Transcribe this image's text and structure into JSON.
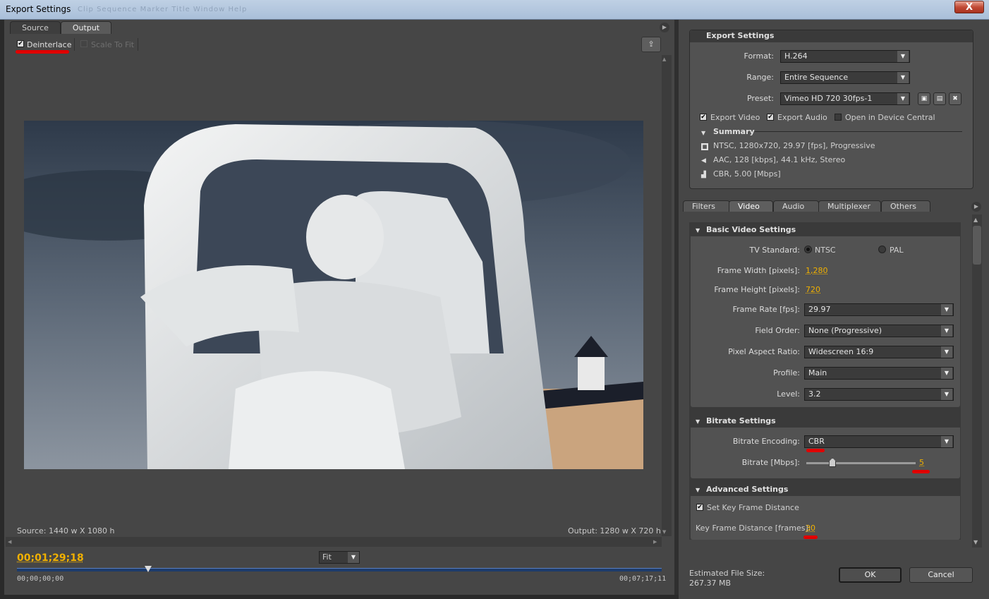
{
  "window": {
    "title": "Export Settings",
    "menu_ghost": "Clip Sequence Marker Title Window Help",
    "close_glyph": "X"
  },
  "left": {
    "tabs": [
      {
        "label": "Source"
      },
      {
        "label": "Output"
      }
    ],
    "deinterlace": {
      "label": "Deinterlace",
      "checked": true
    },
    "scale_to_fit": {
      "label": "Scale To Fit",
      "checked": false,
      "disabled": true
    },
    "source_info": "Source: 1440 w X 1080 h",
    "output_info": "Output: 1280 w X 720 h",
    "timecode": "00;01;29;18",
    "zoom": "Fit",
    "time_start": "00;00;00;00",
    "time_end": "00;07;17;11",
    "playhead_fraction": 0.204
  },
  "export_settings": {
    "header": "Export Settings",
    "format": {
      "label": "Format:",
      "value": "H.264"
    },
    "range": {
      "label": "Range:",
      "value": "Entire Sequence"
    },
    "preset": {
      "label": "Preset:",
      "value": "Vimeo HD 720 30fps-1"
    },
    "export_video": {
      "label": "Export Video",
      "checked": true
    },
    "export_audio": {
      "label": "Export Audio",
      "checked": true
    },
    "device_central": {
      "label": "Open in Device Central",
      "checked": false
    },
    "summary": {
      "label": "Summary",
      "lines": [
        "NTSC, 1280x720, 29.97 [fps], Progressive",
        "AAC, 128 [kbps], 44.1 kHz, Stereo",
        "CBR, 5.00 [Mbps]"
      ]
    }
  },
  "tabs": [
    {
      "label": "Filters"
    },
    {
      "label": "Video"
    },
    {
      "label": "Audio"
    },
    {
      "label": "Multiplexer"
    },
    {
      "label": "Others"
    }
  ],
  "basic_video": {
    "header": "Basic Video Settings",
    "tv_standard": {
      "label": "TV Standard:",
      "ntsc": "NTSC",
      "pal": "PAL",
      "selected": "NTSC"
    },
    "frame_width": {
      "label": "Frame Width [pixels]:",
      "value": "1,280"
    },
    "frame_height": {
      "label": "Frame Height [pixels]:",
      "value": "720"
    },
    "frame_rate": {
      "label": "Frame Rate [fps]:",
      "value": "29.97"
    },
    "field_order": {
      "label": "Field Order:",
      "value": "None (Progressive)"
    },
    "pixel_aspect": {
      "label": "Pixel Aspect Ratio:",
      "value": "Widescreen 16:9"
    },
    "profile": {
      "label": "Profile:",
      "value": "Main"
    },
    "level": {
      "label": "Level:",
      "value": "3.2"
    }
  },
  "bitrate": {
    "header": "Bitrate Settings",
    "encoding": {
      "label": "Bitrate Encoding:",
      "value": "CBR"
    },
    "bitrate": {
      "label": "Bitrate [Mbps]:",
      "value": "5",
      "slider_fraction": 0.24
    }
  },
  "advanced": {
    "header": "Advanced Settings",
    "set_key_frame": {
      "label": "Set Key Frame Distance",
      "checked": true
    },
    "key_frame_distance": {
      "label": "Key Frame Distance [frames]:",
      "value": "30"
    }
  },
  "footer": {
    "estimated_label": "Estimated File Size:",
    "estimated_value": "267.37 MB",
    "ok": "OK",
    "cancel": "Cancel"
  },
  "colors": {
    "accent_value": "#f0b000",
    "annotation_red": "#e00000",
    "panel": "#464646"
  }
}
